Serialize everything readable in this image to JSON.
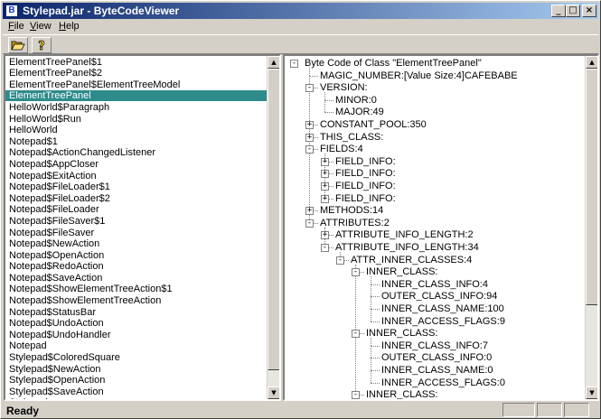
{
  "window": {
    "title": "Stylepad.jar - ByteCodeViewer",
    "app_icon": "B"
  },
  "titlebar_buttons": {
    "minimize": "_",
    "maximize": "□",
    "close": "×"
  },
  "menu": [
    {
      "key": "F",
      "rest": "ile"
    },
    {
      "key": "V",
      "rest": "iew"
    },
    {
      "key": "H",
      "rest": "elp"
    }
  ],
  "toolbar": {
    "open_icon": "folder-open-icon",
    "help_icon": "question-icon"
  },
  "class_list": [
    "ElementTreePanel$1",
    "ElementTreePanel$2",
    "ElementTreePanel$ElementTreeModel",
    "ElementTreePanel",
    "HelloWorld$Paragraph",
    "HelloWorld$Run",
    "HelloWorld",
    "Notepad$1",
    "Notepad$ActionChangedListener",
    "Notepad$AppCloser",
    "Notepad$ExitAction",
    "Notepad$FileLoader$1",
    "Notepad$FileLoader$2",
    "Notepad$FileLoader",
    "Notepad$FileSaver$1",
    "Notepad$FileSaver",
    "Notepad$NewAction",
    "Notepad$OpenAction",
    "Notepad$RedoAction",
    "Notepad$SaveAction",
    "Notepad$ShowElementTreeAction$1",
    "Notepad$ShowElementTreeAction",
    "Notepad$StatusBar",
    "Notepad$UndoAction",
    "Notepad$UndoHandler",
    "Notepad",
    "Stylepad$ColoredSquare",
    "Stylepad$NewAction",
    "Stylepad$OpenAction",
    "Stylepad$SaveAction",
    "Stylepad"
  ],
  "selected_index": 3,
  "tree": [
    {
      "label": "Byte Code of Class \"ElementTreePanel\"",
      "level": 0,
      "exp": "-"
    },
    {
      "label": "MAGIC_NUMBER:[Value Size:4]CAFEBABE",
      "level": 1,
      "exp": ""
    },
    {
      "label": "VERSION:",
      "level": 1,
      "exp": "-"
    },
    {
      "label": "MINOR:0",
      "level": 2,
      "exp": ""
    },
    {
      "label": "MAJOR:49",
      "level": 2,
      "exp": ""
    },
    {
      "label": "CONSTANT_POOL:350",
      "level": 1,
      "exp": "+"
    },
    {
      "label": "THIS_CLASS:",
      "level": 1,
      "exp": "+"
    },
    {
      "label": "FIELDS:4",
      "level": 1,
      "exp": "-"
    },
    {
      "label": "FIELD_INFO:",
      "level": 2,
      "exp": "+"
    },
    {
      "label": "FIELD_INFO:",
      "level": 2,
      "exp": "+"
    },
    {
      "label": "FIELD_INFO:",
      "level": 2,
      "exp": "+"
    },
    {
      "label": "FIELD_INFO:",
      "level": 2,
      "exp": "+"
    },
    {
      "label": "METHODS:14",
      "level": 1,
      "exp": "+"
    },
    {
      "label": "ATTRIBUTES:2",
      "level": 1,
      "exp": "-"
    },
    {
      "label": "ATTRIBUTE_INFO_LENGTH:2",
      "level": 2,
      "exp": "+"
    },
    {
      "label": "ATTRIBUTE_INFO_LENGTH:34",
      "level": 2,
      "exp": "-"
    },
    {
      "label": "ATTR_INNER_CLASSES:4",
      "level": 3,
      "exp": "-"
    },
    {
      "label": "INNER_CLASS:",
      "level": 4,
      "exp": "-"
    },
    {
      "label": "INNER_CLASS_INFO:4",
      "level": 5,
      "exp": ""
    },
    {
      "label": "OUTER_CLASS_INFO:94",
      "level": 5,
      "exp": ""
    },
    {
      "label": "INNER_CLASS_NAME:100",
      "level": 5,
      "exp": ""
    },
    {
      "label": "INNER_ACCESS_FLAGS:9",
      "level": 5,
      "exp": ""
    },
    {
      "label": "INNER_CLASS:",
      "level": 4,
      "exp": "-"
    },
    {
      "label": "INNER_CLASS_INFO:7",
      "level": 5,
      "exp": ""
    },
    {
      "label": "OUTER_CLASS_INFO:0",
      "level": 5,
      "exp": ""
    },
    {
      "label": "INNER_CLASS_NAME:0",
      "level": 5,
      "exp": ""
    },
    {
      "label": "INNER_ACCESS_FLAGS:0",
      "level": 5,
      "exp": ""
    },
    {
      "label": "INNER_CLASS:",
      "level": 4,
      "exp": "-"
    }
  ],
  "status": {
    "text": "Ready"
  }
}
